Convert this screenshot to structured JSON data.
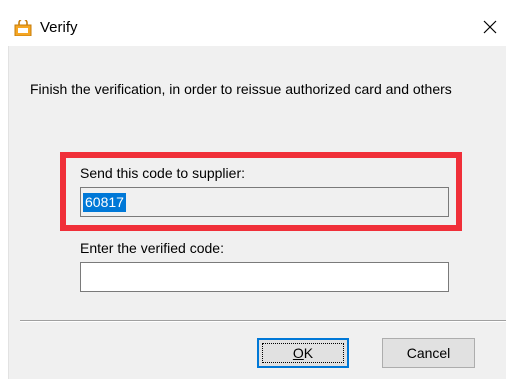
{
  "window": {
    "title": "Verify",
    "icon": "app-lock-icon"
  },
  "message": "Finish the verification, in order to reissue authorized card and others",
  "send_code": {
    "label": "Send this code to supplier:",
    "value": "60817"
  },
  "verified_code": {
    "label": "Enter the verified code:",
    "value": ""
  },
  "buttons": {
    "ok_mnemonic": "O",
    "ok_rest": "K",
    "cancel": "Cancel"
  },
  "colors": {
    "highlight_border": "#f02f39",
    "selection": "#0078d7",
    "client_bg": "#f0f0f0"
  }
}
